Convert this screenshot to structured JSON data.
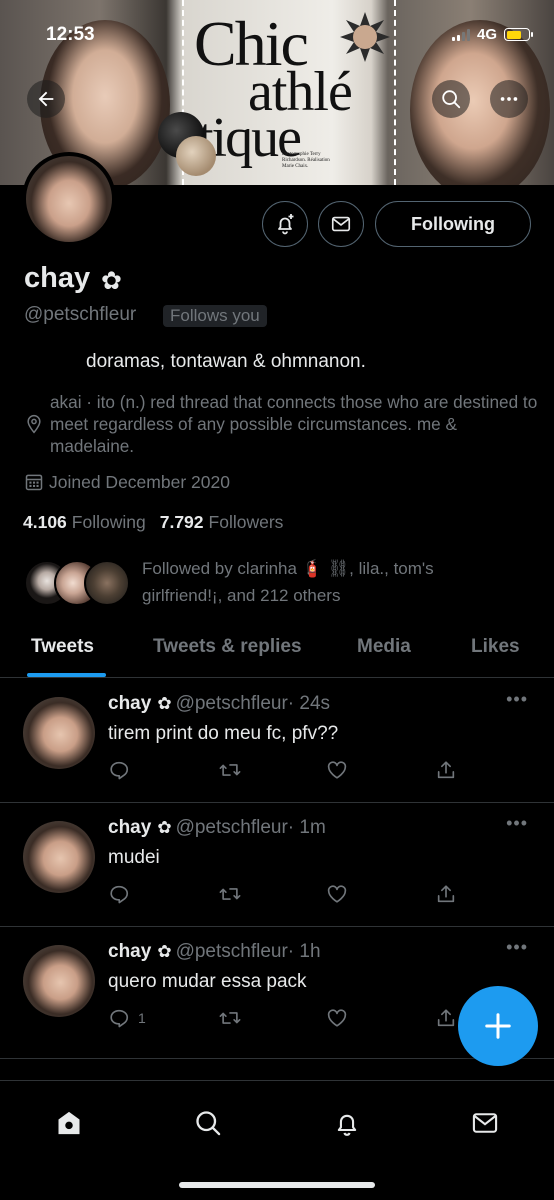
{
  "status_bar": {
    "time": "12:53",
    "network": "4G"
  },
  "banner": {
    "mag_line1": "Chic",
    "mag_line2": "athlé",
    "mag_line3": "tique",
    "mag_credit": "Photographie Terry Richardson. Réalisation Marie Chaix."
  },
  "profile": {
    "name": "chay",
    "name_emoji": "✿",
    "handle": "@petschfleur",
    "follows_you": "Follows you",
    "bio": "doramas, tontawan & ohmnanon.",
    "location": "akai · ito (n.) red thread that connects those who are destined to meet regardless of any possible circumstances. me & madelaine.",
    "joined": "Joined December 2020",
    "following_count": "4.106",
    "following_label": "Following",
    "followers_count": "7.792",
    "followers_label": "Followers",
    "followed_by": "Followed by clarinha 🧯 ⛓, lila., tom's girlfriend!¡, and 212 others",
    "follow_button": "Following"
  },
  "tabs": [
    {
      "label": "Tweets",
      "active": true
    },
    {
      "label": "Tweets & replies",
      "active": false
    },
    {
      "label": "Media",
      "active": false
    },
    {
      "label": "Likes",
      "active": false
    }
  ],
  "tweets": [
    {
      "name": "chay",
      "emoji": "✿",
      "handle": "@petschfleur",
      "time": "· 24s",
      "text": "tirem print do meu fc, pfv??",
      "reply_count": ""
    },
    {
      "name": "chay",
      "emoji": "✿",
      "handle": "@petschfleur",
      "time": "· 1m",
      "text": "mudei",
      "reply_count": ""
    },
    {
      "name": "chay",
      "emoji": "✿",
      "handle": "@petschfleur",
      "time": "· 1h",
      "text": "quero mudar essa pack",
      "reply_count": "1"
    }
  ],
  "more_glyph": "•••",
  "colors": {
    "accent": "#1d9bf0",
    "background": "#000000",
    "muted": "#71767b",
    "text": "#e7e9ea",
    "battery": "#ffd60a"
  },
  "icons": [
    "back-arrow-icon",
    "search-icon",
    "more-icon",
    "bell-plus-icon",
    "mail-icon",
    "location-pin-icon",
    "calendar-icon",
    "reply-icon",
    "retweet-icon",
    "like-icon",
    "share-icon",
    "compose-icon",
    "home-icon",
    "notifications-icon",
    "messages-icon"
  ]
}
